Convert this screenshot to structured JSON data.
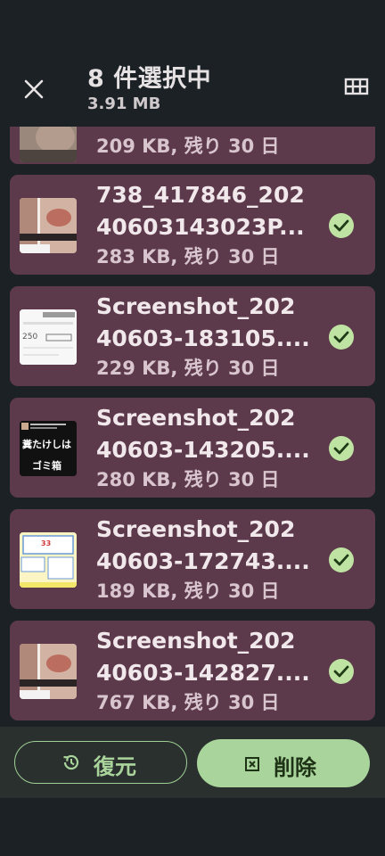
{
  "header": {
    "title": "8 件選択中",
    "subtitle": "3.91 MB",
    "close_icon": "close-icon",
    "grid_icon": "grid-view-icon"
  },
  "items": [
    {
      "meta": "209 KB, 残り 30 日",
      "selected": true
    },
    {
      "name_line1": "738_417846_202",
      "name_line2": "40603143023P...",
      "meta": "283 KB, 残り 30 日",
      "selected": true
    },
    {
      "name_line1": "Screenshot_202",
      "name_line2": "40603-183105....",
      "meta": "229 KB, 残り 30 日",
      "selected": true,
      "thumb_text": "250"
    },
    {
      "name_line1": "Screenshot_202",
      "name_line2": "40603-143205....",
      "meta": "280 KB, 残り 30 日",
      "selected": true,
      "thumb_text_1": "糞たけしは",
      "thumb_text_2": "ゴミ箱"
    },
    {
      "name_line1": "Screenshot_202",
      "name_line2": "40603-172743....",
      "meta": "189 KB, 残り 30 日",
      "selected": true,
      "thumb_text": "33"
    },
    {
      "name_line1": "Screenshot_202",
      "name_line2": "40603-142827....",
      "meta": "767 KB, 残り 30 日",
      "selected": true
    }
  ],
  "actions": {
    "restore_label": "復元",
    "delete_label": "削除",
    "restore_icon": "history-icon",
    "delete_icon": "delete-box-icon"
  },
  "colors": {
    "background": "#1b2125",
    "card": "#5d3a4b",
    "accent": "#a9d49b",
    "check": "#bfe3a2"
  }
}
